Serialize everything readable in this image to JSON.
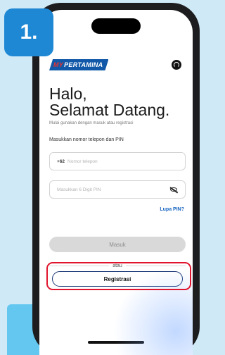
{
  "step": {
    "label": "1."
  },
  "brand": {
    "prefix": "MY",
    "name": "PERTAMINA"
  },
  "header": {
    "help_icon": "headset-icon"
  },
  "greeting": {
    "line1": "Halo,",
    "line2": "Selamat Datang."
  },
  "subtitle": "Mulai gunakan dengan masuk atau registrasi",
  "form": {
    "label": "Masukkan nomor telepon dan PIN",
    "phone": {
      "prefix": "+62",
      "placeholder": "Nomor telepon"
    },
    "pin": {
      "placeholder": "Masukkan 6 Digit PIN",
      "toggle_icon": "eye-off-icon"
    }
  },
  "forgot_pin": "Lupa PIN?",
  "login_button": "Masuk",
  "divider_text": "atau",
  "register_button": "Registrasi",
  "colors": {
    "badge": "#1e88d4",
    "highlight": "#e0152d",
    "link": "#1765c0",
    "brand": "#1158a8"
  }
}
